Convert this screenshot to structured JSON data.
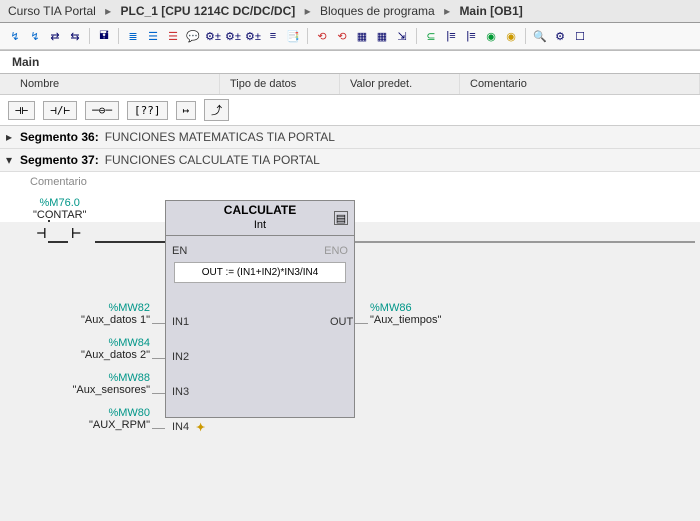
{
  "breadcrumb": {
    "items": [
      "Curso TIA Portal",
      "PLC_1 [CPU 1214C DC/DC/DC]",
      "Bloques de programa",
      "Main [OB1]"
    ]
  },
  "mainTab": "Main",
  "interfaceCols": [
    "Nombre",
    "Tipo de datos",
    "Valor predet.",
    "Comentario"
  ],
  "segments": [
    {
      "num": "Segmento 36:",
      "desc": "FUNCIONES MATEMATICAS TIA PORTAL"
    },
    {
      "num": "Segmento 37:",
      "desc": "FUNCIONES CALCULATE TIA PORTAL"
    }
  ],
  "commentLabel": "Comentario",
  "contact": {
    "addr": "%M76.0",
    "name": "\"CONTAR\""
  },
  "calc": {
    "title": "CALCULATE",
    "type": "Int",
    "expr": "OUT :=   (IN1+IN2)*IN3/IN4",
    "en": "EN",
    "eno": "ENO",
    "out": "OUT"
  },
  "inputs": [
    {
      "addr": "%MW82",
      "name": "\"Aux_datos 1\"",
      "port": "IN1"
    },
    {
      "addr": "%MW84",
      "name": "\"Aux_datos 2\"",
      "port": "IN2"
    },
    {
      "addr": "%MW88",
      "name": "\"Aux_sensores\"",
      "port": "IN3"
    },
    {
      "addr": "%MW80",
      "name": "\"AUX_RPM\"",
      "port": "IN4"
    }
  ],
  "output": {
    "addr": "%MW86",
    "name": "\"Aux_tiempos\""
  }
}
